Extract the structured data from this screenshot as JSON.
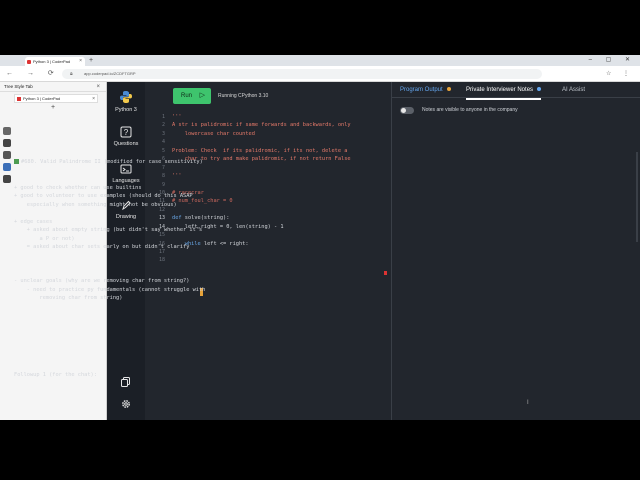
{
  "browser": {
    "tab_title": "Python 3 | CoderPad",
    "url": "app.coderpad.io/ZCDFTGRP",
    "new_tab": "+",
    "window_controls": "– ▢ ✕",
    "nav_buttons": "← → ⟳",
    "addr_icons": "☆ ⋮"
  },
  "tree_tabs": {
    "title": "Tree Style Tab",
    "items": [
      {
        "label": "Python 3 | CoderPad"
      }
    ],
    "add": "+"
  },
  "nav": {
    "lang": "Python 3",
    "questions": "Questions",
    "languages": "Languages",
    "drawing": "Drawing"
  },
  "editor": {
    "run_label": "Run",
    "runtime": "Running CPython 3.10",
    "line_numbers": [
      "1",
      "2",
      "3",
      "4",
      "5",
      "6",
      "7",
      "8",
      "9",
      "10",
      "11",
      "12",
      "13",
      "14",
      "15",
      "16",
      "17",
      "18"
    ],
    "lines": [
      {
        "cls": "c-str",
        "text": "'''"
      },
      {
        "cls": "c-str",
        "text": "A str is palidromic if same forwards and backwards, only"
      },
      {
        "cls": "c-str",
        "text": "    lowercase char counted"
      },
      {
        "cls": "c-str",
        "text": ""
      },
      {
        "cls": "c-str",
        "text": "Problem: Check  if its palidromic, if its not, delete a"
      },
      {
        "cls": "c-str",
        "text": "    char to try and make palidromic, if not return False"
      },
      {
        "cls": "c-str",
        "text": ""
      },
      {
        "cls": "c-str",
        "text": "'''"
      },
      {
        "cls": "c-norm",
        "text": ""
      },
      {
        "cls": "c-com",
        "text": "# racecrar"
      },
      {
        "cls": "c-com",
        "text": "# num_foul_char = 0"
      },
      {
        "cls": "c-norm",
        "text": ""
      },
      {
        "cls": "c-norm",
        "text": "def solve(string):"
      },
      {
        "cls": "c-norm",
        "text": "    left,right = 0, len(string) - 1"
      },
      {
        "cls": "c-norm",
        "text": ""
      },
      {
        "cls": "c-norm",
        "text": "    while left <= right:"
      },
      {
        "cls": "c-norm",
        "text": ""
      },
      {
        "cls": "c-norm",
        "text": ""
      }
    ]
  },
  "right_pane": {
    "tabs": {
      "program_output": "Program Output",
      "private_notes": "Private Interviewer Notes",
      "ai_assist": "AI Assist"
    },
    "notice": "Notes are visible to anyone in the company",
    "notes": [
      {
        "check": true,
        "text": "#680. Valid Palindrome II (modified for case sensitivity)"
      },
      {
        "text": ""
      },
      {
        "text": ""
      },
      {
        "text": "+ good to check whether can use builtins"
      },
      {
        "text": "+ good to volunteer to use examples (should do this ASAP"
      },
      {
        "text": "    especially when something might not be obvious)"
      },
      {
        "text": ""
      },
      {
        "text": "+ edge cases"
      },
      {
        "text": "    + asked about empty string (but didn't say whether it's"
      },
      {
        "text": "        a P or not)"
      },
      {
        "text": "    = asked about char sets early on but didn't clarify"
      },
      {
        "text": ""
      },
      {
        "text": ""
      },
      {
        "text": ""
      },
      {
        "text": "- unclear goals (why are we removing char from string?)"
      },
      {
        "text": "    - need to practice py fundamentals (cannot struggle with"
      },
      {
        "text": "        removing char from string)"
      },
      {
        "text": ""
      },
      {
        "text": ""
      },
      {
        "text": ""
      },
      {
        "text": ""
      },
      {
        "text": ""
      },
      {
        "text": ""
      },
      {
        "text": ""
      },
      {
        "text": ""
      },
      {
        "text": "Followup 1 (for the chat):"
      }
    ]
  },
  "colors": {
    "run": "#3ec46d",
    "program_output": "#65a7f0",
    "dot_orange": "#e7a33a",
    "dot_blue": "#65a7f0"
  }
}
